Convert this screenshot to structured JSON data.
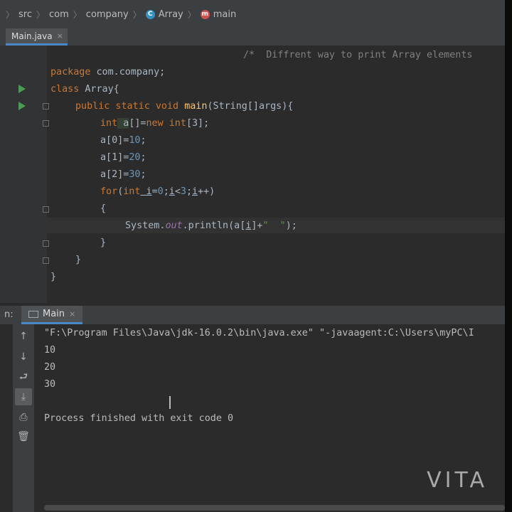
{
  "breadcrumb": {
    "items": [
      "src",
      "com",
      "company",
      "Array",
      "main"
    ]
  },
  "editor_tab": {
    "label": "Main.java",
    "close": "×"
  },
  "code": {
    "comment": "/*  Diffrent way to print Array elements",
    "l1_kw": "package",
    "l1_rest": " com.company;",
    "l2_kw": "class",
    "l2_rest": " Array{",
    "l3_kw": "public static void",
    "l3_fn": "main",
    "l3_rest": "(String[]args){",
    "l4_kw": "int",
    "l4_a": " a",
    "l4_mid": "[]=",
    "l4_kw2": "new int",
    "l4_rest": "[3];",
    "l5_pre": "a[0]=",
    "l5_num": "10",
    "l5_end": ";",
    "l6_pre": "a[1]=",
    "l6_num": "20",
    "l6_end": ";",
    "l7_pre": "a[2]=",
    "l7_num": "30",
    "l7_end": ";",
    "l8_kw": "for",
    "l8_p1": "(",
    "l8_kw2": "int",
    "l8_i": " i",
    "l8_eq": "=",
    "l8_n0": "0",
    "l8_s": ";",
    "l8_i2": "i",
    "l8_lt": "<",
    "l8_n3": "3",
    "l8_s2": ";",
    "l8_i3": "i",
    "l8_end": "++)",
    "l9": "{",
    "l10_pre": "System.",
    "l10_fld": "out",
    "l10_mid": ".println(a[",
    "l10_i": "i",
    "l10_mid2": "]+",
    "l10_str": "\"  \"",
    "l10_end": ");",
    "l11": "}",
    "l12": "}",
    "l13": "}"
  },
  "run_panel": {
    "label": "n:",
    "tab_label": "Main",
    "close": "×"
  },
  "console": {
    "command": "\"F:\\Program Files\\Java\\jdk-16.0.2\\bin\\java.exe\" \"-javaagent:C:\\Users\\myPC\\I",
    "out1": "10",
    "out2": "20",
    "out3": "30",
    "finish": "Process finished with exit code 0"
  },
  "tool_icons": [
    "up-arrow-icon",
    "down-arrow-icon",
    "soft-wrap-icon",
    "scroll-to-end-icon",
    "print-icon",
    "trash-icon"
  ],
  "watermark": "VITA"
}
